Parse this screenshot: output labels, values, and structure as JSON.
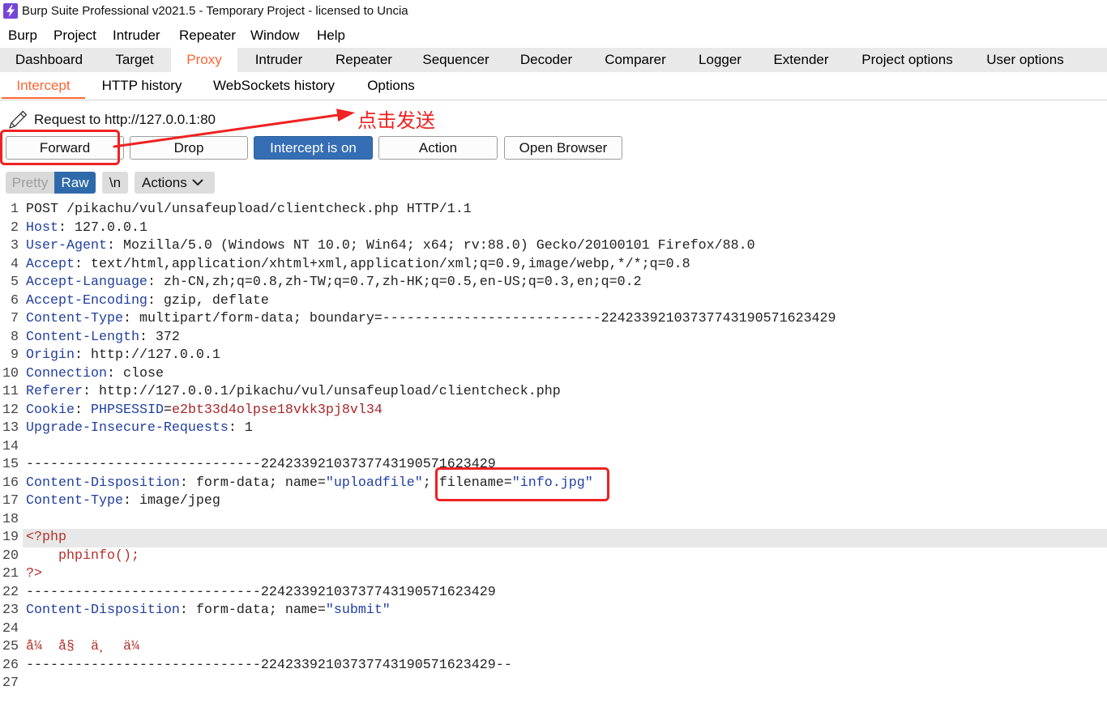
{
  "window": {
    "title": "Burp Suite Professional v2021.5 - Temporary Project - licensed to Uncia"
  },
  "icons": {
    "app": "burp-logo-icon",
    "request": "pencil-icon",
    "actions": "chevron-down-icon"
  },
  "menu": [
    "Burp",
    "Project",
    "Intruder",
    "Repeater",
    "Window",
    "Help"
  ],
  "main_tabs": {
    "items": [
      "Dashboard",
      "Target",
      "Proxy",
      "Intruder",
      "Repeater",
      "Sequencer",
      "Decoder",
      "Comparer",
      "Logger",
      "Extender",
      "Project options",
      "User options"
    ],
    "selected_index": 2
  },
  "sub_tabs": {
    "items": [
      "Intercept",
      "HTTP history",
      "WebSockets history",
      "Options"
    ],
    "selected_index": 0
  },
  "intercept": {
    "request_label": "Request to http://127.0.0.1:80",
    "forward": "Forward",
    "drop": "Drop",
    "intercept_toggle": "Intercept is on",
    "intercept_on": true,
    "action": "Action",
    "open_browser": "Open Browser"
  },
  "editor_toolbar": {
    "pretty": "Pretty",
    "raw": "Raw",
    "raw_selected": true,
    "newline": "\\n",
    "actions": "Actions"
  },
  "editor": {
    "highlighted_line": 19,
    "lines": [
      {
        "n": 1,
        "tokens": [
          {
            "t": "POST /pikachu/vul/unsafeupload/clientcheck.php HTTP/1.1"
          }
        ]
      },
      {
        "n": 2,
        "tokens": [
          {
            "t": "Host",
            "c": "#23409f"
          },
          {
            "t": ": 127.0.0.1"
          }
        ]
      },
      {
        "n": 3,
        "tokens": [
          {
            "t": "User-Agent",
            "c": "#23409f"
          },
          {
            "t": ": Mozilla/5.0 (Windows NT 10.0; Win64; x64; rv:88.0) Gecko/20100101 Firefox/88.0"
          }
        ]
      },
      {
        "n": 4,
        "tokens": [
          {
            "t": "Accept",
            "c": "#23409f"
          },
          {
            "t": ": text/html,application/xhtml+xml,application/xml;q=0.9,image/webp,*/*;q=0.8"
          }
        ]
      },
      {
        "n": 5,
        "tokens": [
          {
            "t": "Accept-Language",
            "c": "#23409f"
          },
          {
            "t": ": zh-CN,zh;q=0.8,zh-TW;q=0.7,zh-HK;q=0.5,en-US;q=0.3,en;q=0.2"
          }
        ]
      },
      {
        "n": 6,
        "tokens": [
          {
            "t": "Accept-Encoding",
            "c": "#23409f"
          },
          {
            "t": ": gzip, deflate"
          }
        ]
      },
      {
        "n": 7,
        "tokens": [
          {
            "t": "Content-Type",
            "c": "#23409f"
          },
          {
            "t": ": multipart/form-data; boundary=---------------------------22423392103737743190571623429"
          }
        ]
      },
      {
        "n": 8,
        "tokens": [
          {
            "t": "Content-Length",
            "c": "#23409f"
          },
          {
            "t": ": 372"
          }
        ]
      },
      {
        "n": 9,
        "tokens": [
          {
            "t": "Origin",
            "c": "#23409f"
          },
          {
            "t": ": http://127.0.0.1"
          }
        ]
      },
      {
        "n": 10,
        "tokens": [
          {
            "t": "Connection",
            "c": "#23409f"
          },
          {
            "t": ": close"
          }
        ]
      },
      {
        "n": 11,
        "tokens": [
          {
            "t": "Referer",
            "c": "#23409f"
          },
          {
            "t": ": http://127.0.0.1/pikachu/vul/unsafeupload/clientcheck.php"
          }
        ]
      },
      {
        "n": 12,
        "tokens": [
          {
            "t": "Cookie",
            "c": "#23409f"
          },
          {
            "t": ": "
          },
          {
            "t": "PHPSESSID",
            "c": "#23409f"
          },
          {
            "t": "="
          },
          {
            "t": "e2bt33d4olpse18vkk3pj8vl34",
            "c": "#a8262b"
          }
        ]
      },
      {
        "n": 13,
        "tokens": [
          {
            "t": "Upgrade-Insecure-Requests",
            "c": "#23409f"
          },
          {
            "t": ": 1"
          }
        ]
      },
      {
        "n": 14,
        "tokens": []
      },
      {
        "n": 15,
        "tokens": [
          {
            "t": "-----------------------------22423392103737743190571623429"
          }
        ]
      },
      {
        "n": 16,
        "tokens": [
          {
            "t": "Content-Disposition",
            "c": "#23409f"
          },
          {
            "t": ": form-data; name="
          },
          {
            "t": "\"uploadfile\"",
            "c": "#2340a6"
          },
          {
            "t": "; filename="
          },
          {
            "t": "\"info.jpg\"",
            "c": "#2340a6"
          }
        ]
      },
      {
        "n": 17,
        "tokens": [
          {
            "t": "Content-Type",
            "c": "#23409f"
          },
          {
            "t": ": image/jpeg"
          }
        ]
      },
      {
        "n": 18,
        "tokens": []
      },
      {
        "n": 19,
        "tokens": [
          {
            "t": "<?php",
            "c": "#b3302c"
          }
        ]
      },
      {
        "n": 20,
        "tokens": [
          {
            "t": "    phpinfo();",
            "c": "#b3302c"
          }
        ]
      },
      {
        "n": 21,
        "tokens": [
          {
            "t": "?>",
            "c": "#b3302c"
          }
        ]
      },
      {
        "n": 22,
        "tokens": [
          {
            "t": "-----------------------------22423392103737743190571623429"
          }
        ]
      },
      {
        "n": 23,
        "tokens": [
          {
            "t": "Content-Disposition",
            "c": "#23409f"
          },
          {
            "t": ": form-data; name="
          },
          {
            "t": "\"submit\"",
            "c": "#2340a6"
          }
        ]
      },
      {
        "n": 24,
        "tokens": []
      },
      {
        "n": 25,
        "tokens": [
          {
            "t": "å¼  å§  ä¸  ä¼",
            "c": "#b3302c"
          }
        ]
      },
      {
        "n": 26,
        "tokens": [
          {
            "t": "-----------------------------22423392103737743190571623429--"
          }
        ]
      },
      {
        "n": 27,
        "tokens": []
      }
    ]
  },
  "annotation": {
    "label": "点击发送"
  },
  "colors": {
    "accent": "#ff6633",
    "primary": "#356eb4",
    "raw": "#2e6aa9",
    "annot": "#ee2222",
    "curline": "#e8e8e8",
    "plain": "#222222"
  }
}
